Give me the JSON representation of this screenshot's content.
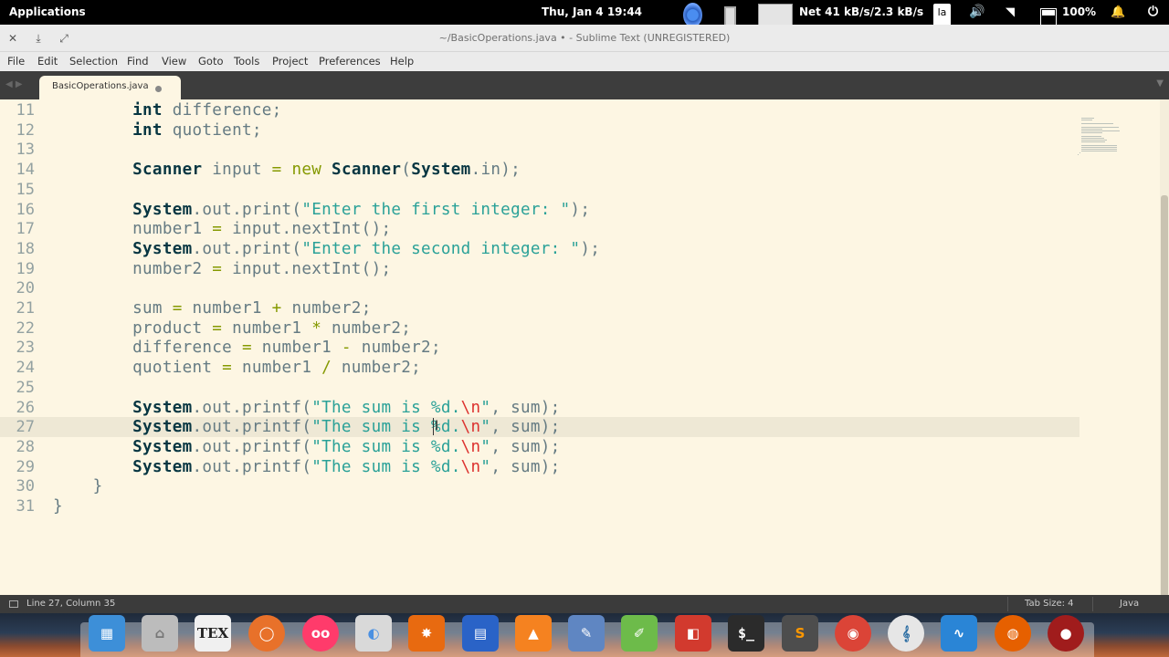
{
  "topbar": {
    "applications": "Applications",
    "clock": "Thu, Jan  4   19:44",
    "network": "Net 41 kB/s/2.3 kB/s",
    "keyboard_layout": "la",
    "battery": "100%"
  },
  "window": {
    "title": "~/BasicOperations.java • - Sublime Text (UNREGISTERED)"
  },
  "menu": [
    "File",
    "Edit",
    "Selection",
    "Find",
    "View",
    "Goto",
    "Tools",
    "Project",
    "Preferences",
    "Help"
  ],
  "tab": {
    "label": "BasicOperations.java",
    "modified": true
  },
  "editor": {
    "current_line": 27,
    "line_numbers": [
      "11",
      "12",
      "13",
      "14",
      "15",
      "16",
      "17",
      "18",
      "19",
      "20",
      "21",
      "22",
      "23",
      "24",
      "25",
      "26",
      "27",
      "28",
      "29",
      "30",
      "31"
    ],
    "code": [
      "        int difference;",
      "        int quotient;",
      "",
      "        Scanner input = new Scanner(System.in);",
      "",
      "        System.out.print(\"Enter the first integer: \");",
      "        number1 = input.nextInt();",
      "        System.out.print(\"Enter the second integer: \");",
      "        number2 = input.nextInt();",
      "",
      "        sum = number1 + number2;",
      "        product = number1 * number2;",
      "        difference = number1 - number2;",
      "        quotient = number1 / number2;",
      "",
      "        System.out.printf(\"The sum is %d.\\n\", sum);",
      "        System.out.printf(\"The sum is %d.\\n\", sum);",
      "        System.out.printf(\"The sum is %d.\\n\", sum);",
      "        System.out.printf(\"The sum is %d.\\n\", sum);",
      "    }",
      "}"
    ]
  },
  "status": {
    "position": "Line 27, Column 35",
    "tab_size": "Tab Size: 4",
    "syntax": "Java"
  },
  "dock": {
    "icons": [
      "desktop-icon",
      "files-icon",
      "tex-icon",
      "ubuntu-icon",
      "flickr-icon",
      "toggle-icon",
      "burst-icon",
      "document-icon",
      "vlc-icon",
      "pen-icon",
      "draw-icon",
      "pdf-icon",
      "terminal-icon",
      "sublime-icon",
      "chrome-icon",
      "musescore-icon",
      "monitor-icon",
      "firefox-icon",
      "app-icon"
    ],
    "terminal_label": "$_",
    "tex_label": "TEX"
  },
  "colors": {
    "editor_bg": "#fdf6e3",
    "keyword": "#073642",
    "operator": "#859900",
    "string": "#2aa198",
    "escape": "#dc322f",
    "plain": "#657b83",
    "gutter": "#93a1a1"
  }
}
